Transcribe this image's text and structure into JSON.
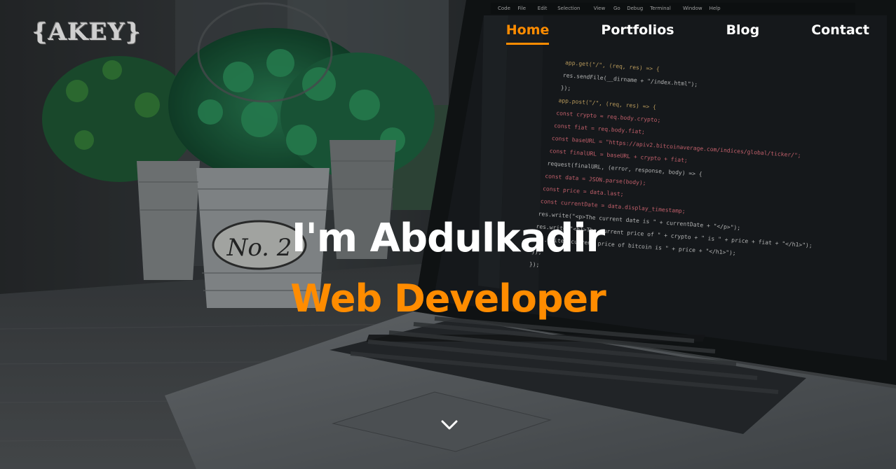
{
  "logo": {
    "text": "{AKEY}"
  },
  "nav": {
    "items": [
      {
        "label": "Home",
        "active": true
      },
      {
        "label": "Portfolios",
        "active": false
      },
      {
        "label": "Blog",
        "active": false
      },
      {
        "label": "Contact",
        "active": false
      }
    ]
  },
  "hero": {
    "title": "I'm Abdulkadir",
    "subtitle": "Web Developer",
    "scroll_icon": "chevron-down-icon"
  },
  "code_editor": {
    "menu": [
      "Code",
      "File",
      "Edit",
      "Selection",
      "View",
      "Go",
      "Debug",
      "Terminal",
      "Window",
      "Help"
    ],
    "lines": [
      "app.get(\"/\", (req, res) => {",
      "  res.sendFile(__dirname + \"/index.html\");",
      "});",
      "app.post(\"/\", (req, res) => {",
      "  const crypto = req.body.crypto;",
      "  const fiat = req.body.fiat;",
      "  const baseURL = \"https://apiv2.bitcoinaverage.com/indices/global/ticker/\";",
      "  const finalURL = baseURL + crypto + fiat;",
      "  request(finalURL, (error, response, body) => {",
      "    const data = JSON.parse(body);",
      "    const price = data.last;",
      "    const currentDate = data.display_timestamp;",
      "    res.write(\"<p>The current date is \" + currentDate + \"</p>\");",
      "    res.write(\"<h1>The current price of \" + crypto + \" is \" + price + fiat + \"</h1>\");",
      "    res.write(\"current price of bitcoin is \" + price + \"</h1>\");",
      "  });",
      "});"
    ]
  },
  "colors": {
    "accent": "#ff8c00",
    "text": "#ffffff"
  }
}
